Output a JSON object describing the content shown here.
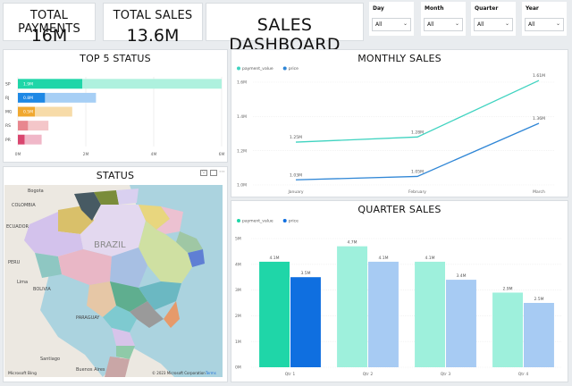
{
  "kpis": [
    {
      "title": "TOTAL PAYMENTS",
      "value": "16M"
    },
    {
      "title": "TOTAL SALES",
      "value": "13.6M"
    }
  ],
  "dashboard": {
    "title": "SALES DASHBOARD"
  },
  "slicers": [
    {
      "label": "Day",
      "value": "All"
    },
    {
      "label": "Month",
      "value": "All"
    },
    {
      "label": "Quarter",
      "value": "All"
    },
    {
      "label": "Year",
      "value": "All"
    }
  ],
  "top5": {
    "title": "TOP 5 STATUS",
    "chart_data": {
      "type": "bar",
      "orientation": "horizontal",
      "stacked": true,
      "categories": [
        "SP",
        "RJ",
        "MG",
        "RS",
        "PR"
      ],
      "series": [
        {
          "values": [
            1.9,
            0.8,
            0.5,
            0.3,
            0.2
          ],
          "data_labels": [
            "1.9M",
            "0.8M",
            "0.5M",
            "",
            ""
          ]
        },
        {
          "values": [
            4.1,
            1.5,
            1.1,
            0.6,
            0.5
          ],
          "data_labels": [
            "",
            "",
            "",
            "",
            ""
          ]
        }
      ],
      "xlim": [
        0,
        6
      ],
      "xticks": [
        0,
        2,
        4,
        6
      ],
      "xtick_labels": [
        "0M",
        "2M",
        "4M",
        "6M"
      ],
      "colors_solid": [
        "#1fd6a8",
        "#1e88e5",
        "#f0a830",
        "#e8878f",
        "#d9466f"
      ],
      "colors_light": [
        "#aef1de",
        "#a7cff5",
        "#f7dba8",
        "#f4c6c9",
        "#f0b7c8"
      ],
      "grid": true
    }
  },
  "monthly": {
    "title": "MONTHLY SALES",
    "chart_data": {
      "type": "line",
      "x": [
        "January",
        "February",
        "March"
      ],
      "series": [
        {
          "name": "payment_value",
          "values": [
            1.25,
            1.28,
            1.61
          ],
          "data_labels": [
            "1.25M",
            "1.28M",
            "1.61M"
          ],
          "color": "#3fd3c0"
        },
        {
          "name": "price",
          "values": [
            1.03,
            1.05,
            1.36
          ],
          "data_labels": [
            "1.03M",
            "1.05M",
            "1.36M"
          ],
          "color": "#2f86d6"
        }
      ],
      "ylim": [
        1.0,
        1.6
      ],
      "yticks": [
        1.0,
        1.2,
        1.4,
        1.6
      ],
      "ytick_labels": [
        "1.0M",
        "1.2M",
        "1.4M",
        "1.6M"
      ],
      "legend": "top-left",
      "grid": true
    }
  },
  "quarter": {
    "title": "QUARTER SALES",
    "chart_data": {
      "type": "bar",
      "categories": [
        "Qtr 1",
        "Qtr 2",
        "Qtr 3",
        "Qtr 4"
      ],
      "series": [
        {
          "name": "payment_value",
          "values": [
            4.1,
            4.7,
            4.1,
            2.9
          ],
          "data_labels": [
            "4.1M",
            "4.7M",
            "4.1M",
            "2.9M"
          ]
        },
        {
          "name": "price",
          "values": [
            3.5,
            4.1,
            3.4,
            2.5
          ],
          "data_labels": [
            "3.5M",
            "4.1M",
            "3.4M",
            "2.5M"
          ]
        }
      ],
      "colors_q1": [
        "#1fd6a8",
        "#0f6fe0"
      ],
      "colors_other": [
        "#9ef0dc",
        "#a7cbf3"
      ],
      "ylim": [
        0,
        5
      ],
      "yticks": [
        0,
        1,
        2,
        3,
        4,
        5
      ],
      "ytick_labels": [
        "0M",
        "1M",
        "2M",
        "3M",
        "4M",
        "5M"
      ],
      "legend": "top-left",
      "grid": true
    }
  },
  "status_map": {
    "title": "STATUS",
    "attribution": "© 2023 Microsoft Corporation",
    "attribution_link": "Terms",
    "brand": "Microsoft Bing",
    "places": [
      "Bogota",
      "COLOMBIA",
      "ECUADOR",
      "PERU",
      "Lima",
      "BOLIVIA",
      "BRAZIL",
      "Buenos Aires",
      "Santiago",
      "PARAGUAY"
    ]
  }
}
